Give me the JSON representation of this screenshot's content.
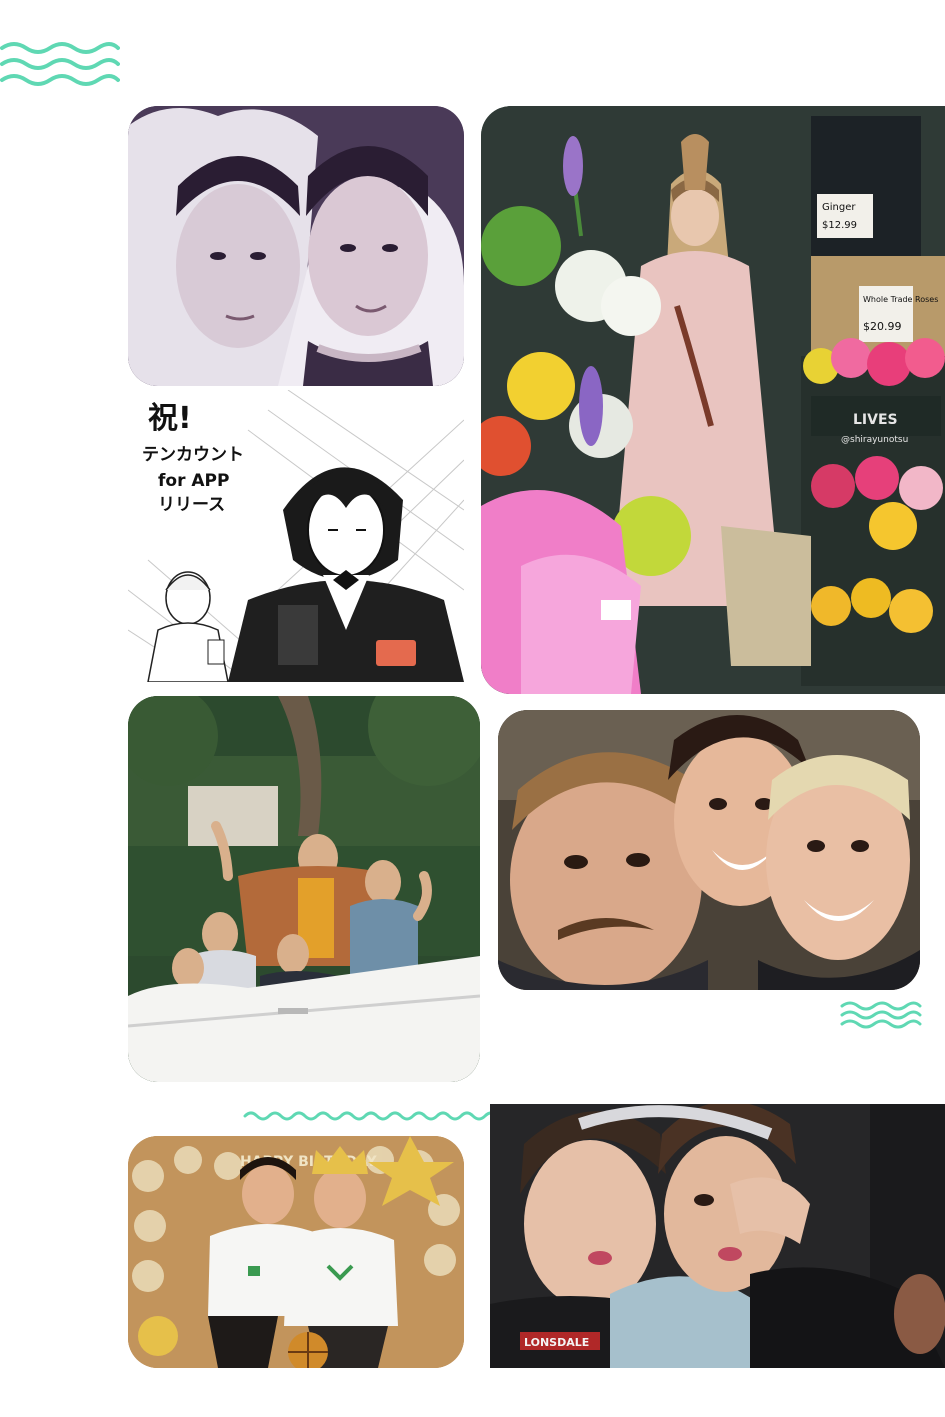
{
  "colors": {
    "accent_wave": "#5fd8b3",
    "background": "#ffffff"
  },
  "icons": [
    "wave-decoration-icon"
  ],
  "collage": {
    "tiles": [
      {
        "name": "photo-two-teens-hood",
        "kind": "sepia-portrait"
      },
      {
        "name": "manga-celebration-illustration",
        "kind": "manga",
        "text": {
          "line1": "祝!",
          "line2": "テンカウント",
          "line3": "for APP",
          "line4": "リリース"
        }
      },
      {
        "name": "photo-woman-flower-stand",
        "kind": "photo"
      },
      {
        "name": "photo-group-waving-car",
        "kind": "photo"
      },
      {
        "name": "photo-three-people-selfie",
        "kind": "photo"
      },
      {
        "name": "photo-two-boys-birthday",
        "kind": "photo"
      },
      {
        "name": "photo-two-young-men-hug",
        "kind": "photo"
      }
    ],
    "signs": {
      "flower_sign_1": "Ginger",
      "flower_sign_1_price": "$12.99",
      "flower_sign_2": "Whole Trade Roses",
      "flower_sign_2_price": "$20.99",
      "store_text": "LIVES",
      "watermark": "@shirayunotsu",
      "hoodie_brand": "LONSDALE",
      "birthday_text": "HAPPY BIRTHDAY"
    }
  }
}
